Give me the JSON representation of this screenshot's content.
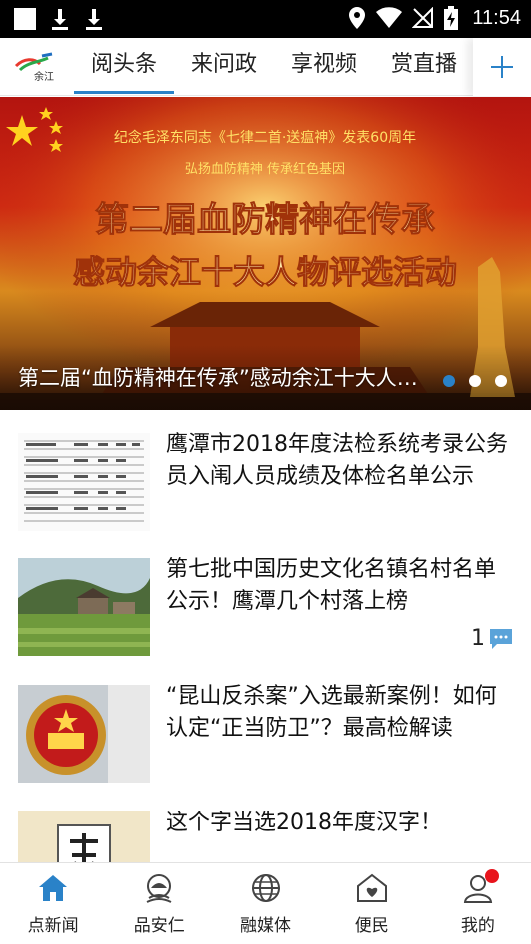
{
  "status_bar": {
    "time": "11:54",
    "icons": [
      "notification-square-icon",
      "download-icon",
      "download-icon",
      "location-icon",
      "wifi-icon",
      "no-sim-icon",
      "battery-charging-icon"
    ]
  },
  "top_nav": {
    "logo_text": "余江",
    "tabs": [
      {
        "label": "阅头条",
        "active": true
      },
      {
        "label": "来问政",
        "active": false
      },
      {
        "label": "享视频",
        "active": false
      },
      {
        "label": "赏直播",
        "active": false
      }
    ],
    "add_icon": "plus-icon",
    "accent_color": "#2a82c8"
  },
  "banner": {
    "headline_top": "纪念毛泽东同志《七律二首·送瘟神》发表60周年",
    "headline_sub": "弘扬血防精神  传承红色基因",
    "title_line1": "第二届血防精神在传承",
    "title_line2": "感动余江十大人物评选活动",
    "caption": "第二届“血防精神在传承”感动余江十大人物评选活动",
    "slide_count": 3,
    "active_slide": 1
  },
  "feed": [
    {
      "title": "鹰潭市2018年度法检系统考录公务员入闱人员成绩及体检名单公示",
      "thumb": "document-table",
      "comments": ""
    },
    {
      "title": "第七批中国历史文化名镇名村名单公示！鹰潭几个村落上榜",
      "thumb": "village-landscape",
      "comments": "1"
    },
    {
      "title": "“昆山反杀案”入选最新案例！如何认定“正当防卫”？最高检解读",
      "thumb": "prosecutor-emblem",
      "comments": ""
    },
    {
      "title": "这个字当选2018年度汉字！",
      "thumb": "chinese-character",
      "comments": ""
    }
  ],
  "bottom_nav": {
    "items": [
      {
        "label": "点新闻",
        "icon": "home-icon",
        "active": true
      },
      {
        "label": "品安仁",
        "icon": "landmark-icon",
        "active": false
      },
      {
        "label": "融媒体",
        "icon": "globe-icon",
        "active": false
      },
      {
        "label": "便民",
        "icon": "service-house-icon",
        "active": false
      },
      {
        "label": "我的",
        "icon": "user-icon",
        "active": false,
        "badge": true
      }
    ],
    "active_color": "#2a82c8",
    "badge_color": "#e8141c"
  }
}
